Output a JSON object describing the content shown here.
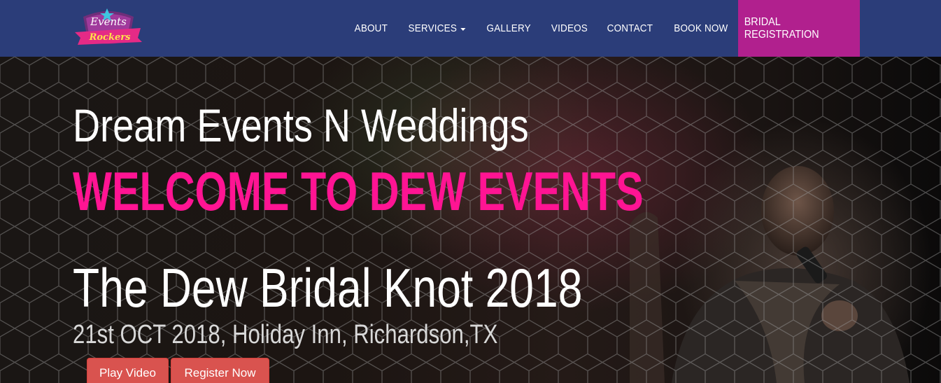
{
  "brand": {
    "logo_text_top": "Events",
    "logo_text_bottom": "Rockers",
    "logo_icon": "events-rockers-logo"
  },
  "nav": {
    "items": [
      {
        "label": "ABOUT"
      },
      {
        "label": "SERVICES"
      },
      {
        "label": "GALLERY"
      },
      {
        "label": "VIDEOS"
      },
      {
        "label": "CONTACT"
      },
      {
        "label": "BOOK NOW"
      }
    ],
    "cta_label": "BRIDAL REGISTRATION"
  },
  "hero": {
    "subtitle": "Dream Events N Weddings",
    "welcome": "WELCOME TO DEW EVENTS",
    "event_title": "The Dew Bridal Knot 2018",
    "event_details": "21st OCT 2018, Holiday Inn, Richardson,TX",
    "play_video_label": "Play Video",
    "register_label": "Register Now"
  },
  "colors": {
    "navbar_bg": "#2b3d79",
    "cta_bg": "#b1208e",
    "accent_pink": "#ff1493",
    "button_red": "#d9534f"
  }
}
